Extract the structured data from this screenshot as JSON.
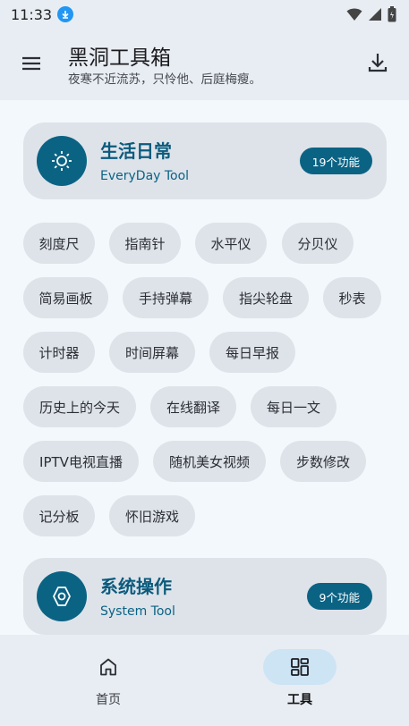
{
  "status": {
    "time": "11:33"
  },
  "app": {
    "title": "黑洞工具箱",
    "subtitle": "夜寒不近流苏，只怜他、后庭梅瘦。"
  },
  "sections": [
    {
      "title": "生活日常",
      "subtitle": "EveryDay Tool",
      "badge": "19个功能",
      "icon": "sun-icon"
    },
    {
      "title": "系统操作",
      "subtitle": "System Tool",
      "badge": "9个功能",
      "icon": "gear-icon"
    }
  ],
  "chips": [
    "刻度尺",
    "指南针",
    "水平仪",
    "分贝仪",
    "简易画板",
    "手持弹幕",
    "指尖轮盘",
    "秒表",
    "计时器",
    "时间屏幕",
    "每日早报",
    "历史上的今天",
    "在线翻译",
    "每日一文",
    "IPTV电视直播",
    "随机美女视频",
    "步数修改",
    "记分板",
    "怀旧游戏"
  ],
  "nav": [
    {
      "label": "首页",
      "icon": "home-icon",
      "active": false
    },
    {
      "label": "工具",
      "icon": "grid-icon",
      "active": true
    }
  ],
  "colors": {
    "accent": "#0b6384",
    "chip": "#dee3ea",
    "background": "#f3f8fc"
  }
}
